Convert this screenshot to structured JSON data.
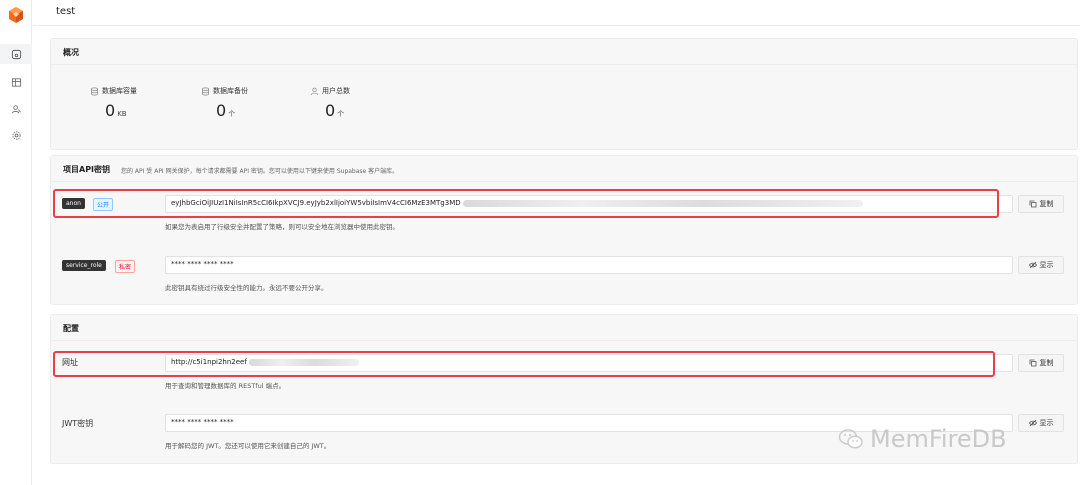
{
  "header": {
    "title": "test"
  },
  "overview": {
    "title": "概况",
    "stats": [
      {
        "label": "数据库容量",
        "value": "0",
        "unit": "KB",
        "icon": "database-icon"
      },
      {
        "label": "数据库备份",
        "value": "0",
        "unit": "个",
        "icon": "database-icon"
      },
      {
        "label": "用户总数",
        "value": "0",
        "unit": "个",
        "icon": "user-icon"
      }
    ]
  },
  "api_keys": {
    "title": "项目API密钥",
    "description": "您的 API 受 API 网关保护，每个请求都需要 API 密钥。您可以使用以下键来使用 Supabase 客户端库。",
    "anon": {
      "tag": "anon",
      "badge": "公开",
      "value": "eyJhbGciOiJIUzI1NiIsInR5cCI6IkpXVCJ9.eyJyb2xlIjoiYW5vbiIsImV4cCI6MzE3MTg3MD",
      "copy_label": "复制",
      "helper": "如果您为表启用了行级安全并配置了策略，则可以安全地在浏览器中使用此密钥。"
    },
    "service_role": {
      "tag": "service_role",
      "badge": "私密",
      "value": "**** **** **** ****",
      "show_label": "显示",
      "helper": "此密钥具有绕过行级安全性的能力。永远不要公开分享。"
    }
  },
  "config": {
    "title": "配置",
    "url": {
      "label": "网址",
      "value": "http://c5i1npi2hn2eef",
      "copy_label": "复制",
      "helper": "用于查询和管理数据库的 RESTful 端点。"
    },
    "jwt": {
      "label": "JWT密钥",
      "value": "**** **** **** ****",
      "show_label": "显示",
      "helper": "用于解码您的 JWT。您还可以使用它来创建自己的 JWT。"
    }
  },
  "watermark": {
    "text": "MemFireDB"
  },
  "colors": {
    "accent_red": "#e8404a",
    "logo_orange": "#f26b1d",
    "blue_tag": "#1677ff"
  }
}
